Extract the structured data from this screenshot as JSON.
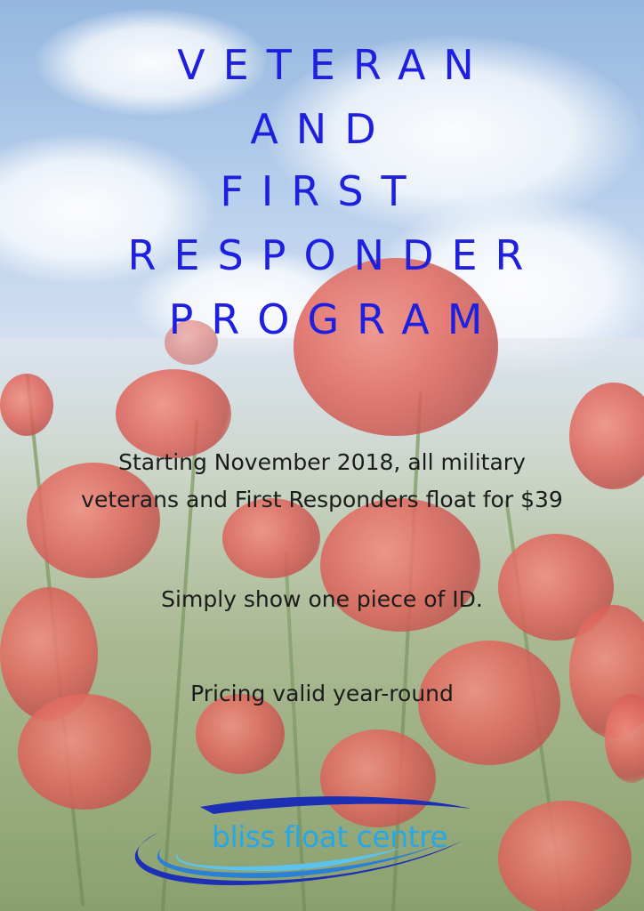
{
  "title_lines": [
    "VETERAN",
    "AND",
    "FIRST",
    "RESPONDER",
    "PROGRAM"
  ],
  "body": {
    "line1": "Starting November 2018, all military",
    "line2": "veterans and First Responders float for $39",
    "line3": "Simply show one piece of ID.",
    "line4": "Pricing valid year-round"
  },
  "logo": {
    "text": "bliss float centre"
  },
  "colors": {
    "title": "#1f1fe0",
    "body_text": "#1c1c1c",
    "logo_text": "#29a6e4",
    "logo_swoosh": "#1d2fb5"
  }
}
